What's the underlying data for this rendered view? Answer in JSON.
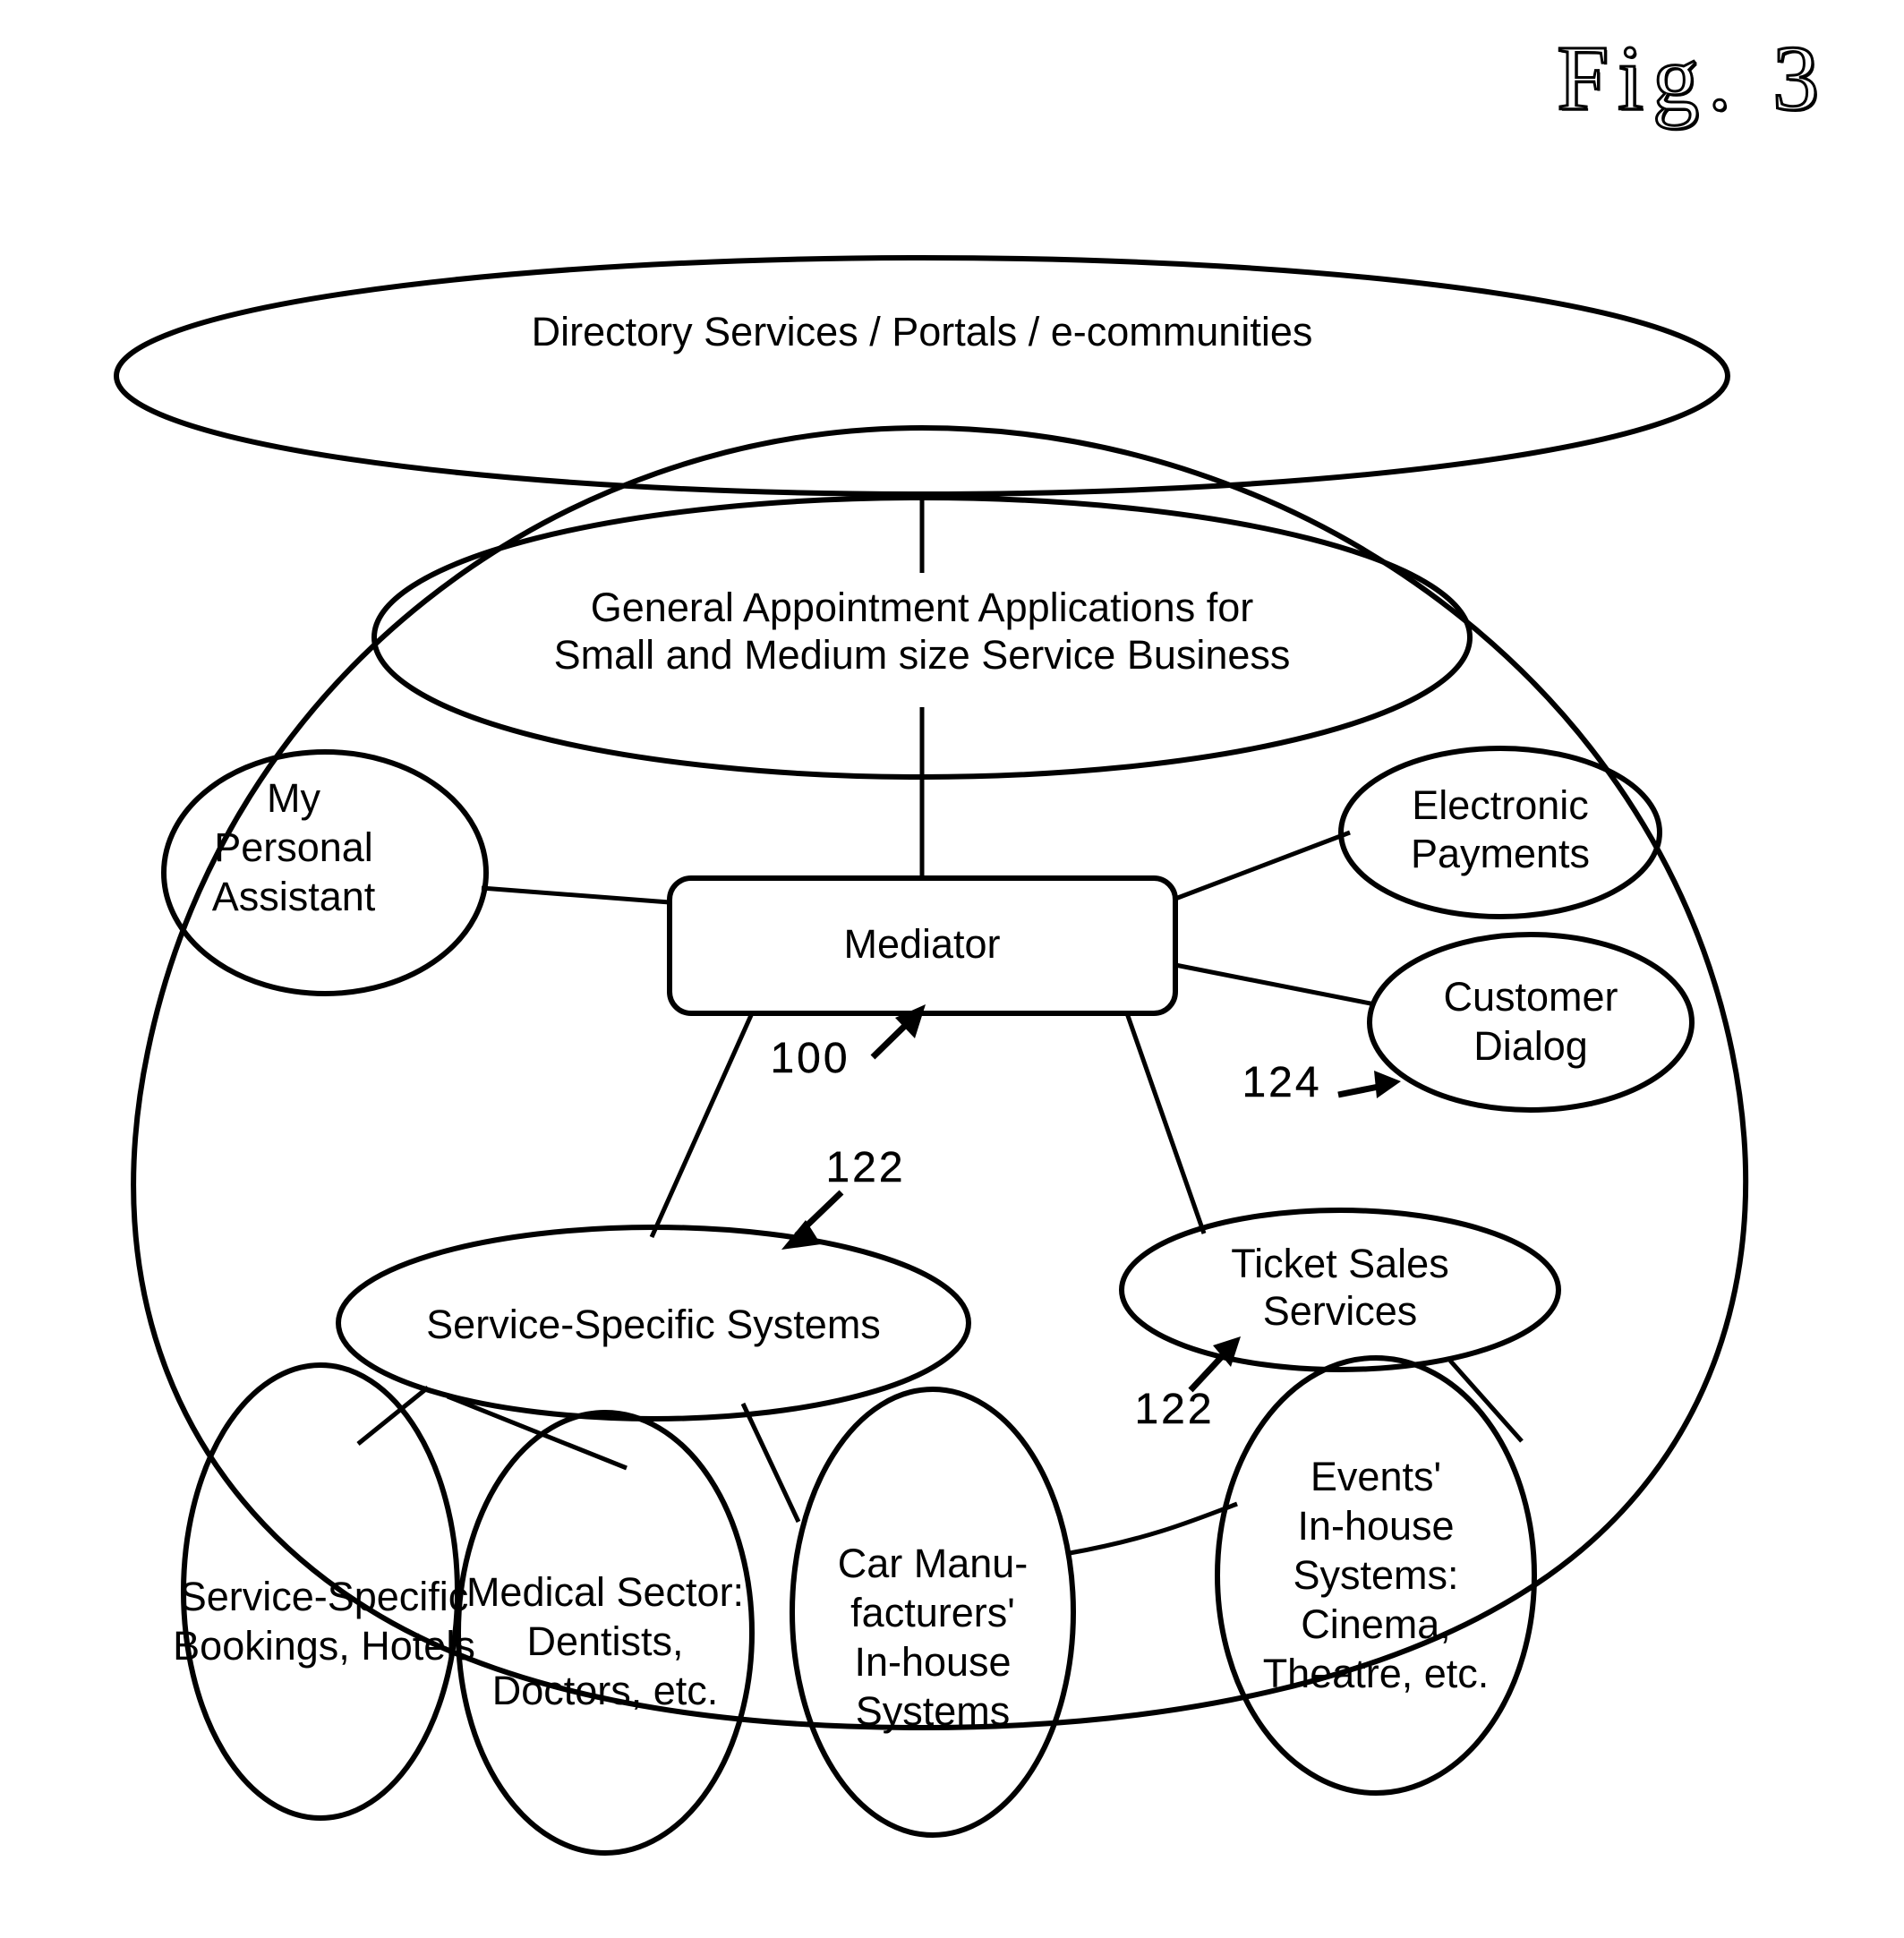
{
  "figure": {
    "title": "Fig.  3"
  },
  "nodes": {
    "directory_services": {
      "label": "Directory  Services  /  Portals  /  e-communities"
    },
    "general_appointment": {
      "line1": "General  Appointment  Applications  for",
      "line2": "Small  and  Medium  size  Service  Business"
    },
    "my_personal_assistant": {
      "line1": "My",
      "line2": "Personal",
      "line3": "Assistant"
    },
    "mediator": {
      "label": "Mediator"
    },
    "electronic_payments": {
      "line1": "Electronic",
      "line2": "Payments"
    },
    "customer_dialog": {
      "line1": "Customer",
      "line2": "Dialog"
    },
    "service_specific_systems": {
      "label": "Service-Specific   Systems"
    },
    "ticket_sales_services": {
      "line1": "Ticket   Sales",
      "line2": "Services"
    },
    "service_specific_bookings": {
      "line1": "Service-Specific",
      "line2": "Bookings,   Hotels"
    },
    "medical_sector": {
      "line1": "Medical   Sector:",
      "line2": "Dentists,",
      "line3": "Doctors,   etc."
    },
    "car_manufacturers": {
      "line1": "Car  Manu-",
      "line2": "facturers'",
      "line3": "In-house",
      "line4": "Systems"
    },
    "events_in_house": {
      "line1": "Events'",
      "line2": "In-house",
      "line3": "Systems:",
      "line4": "Cinema,",
      "line5": "Theatre,   etc."
    }
  },
  "reference_numerals": {
    "mediator_ref": "100",
    "service_specific_ref": "122",
    "ticket_sales_ref": "122",
    "customer_dialog_ref": "124"
  },
  "colors": {
    "stroke": "#000000",
    "background": "#ffffff"
  }
}
